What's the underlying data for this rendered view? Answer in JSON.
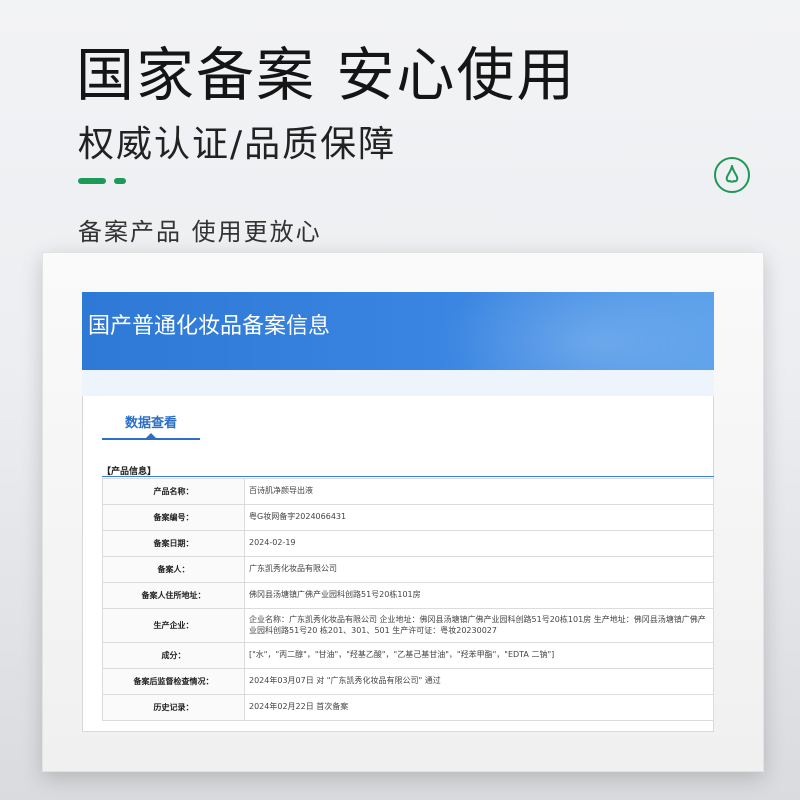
{
  "hero": {
    "title": "国家备案 安心使用",
    "subtitle": "权威认证/品质保障",
    "tagline": "备案产品 使用更放心",
    "accent_color": "#1e9a58",
    "badge_icon": "nose-icon"
  },
  "screen": {
    "banner_title": "国产普通化妆品备案信息",
    "tab_label": "数据查看",
    "section_title": "【产品信息】",
    "rows": [
      {
        "label": "产品名称：",
        "value": "百诗肌净颜导出液"
      },
      {
        "label": "备案编号：",
        "value": "粤G妆网备字2024066431"
      },
      {
        "label": "备案日期：",
        "value": "2024-02-19"
      },
      {
        "label": "备案人：",
        "value": "广东凯秀化妆品有限公司"
      },
      {
        "label": "备案人住所地址：",
        "value": "佛冈县汤塘镇广佛产业园科创路51号20栋101房"
      },
      {
        "label": "生产企业：",
        "value": "企业名称：广东凯秀化妆品有限公司 企业地址：佛冈县汤塘镇广佛产业园科创路51号20栋101房 生产地址：佛冈县汤塘镇广佛产业园科创路51号20 栋201、301、501 生产许可证：粤妆20230027"
      },
      {
        "label": "成分：",
        "value": "[\"水\"，\"丙二醇\"，\"甘油\"，\"羟基乙酸\"，\"乙基己基甘油\"，\"羟苯甲酯\"，\"EDTA 二钠\"]"
      },
      {
        "label": "备案后监督检查情况：",
        "value": "2024年03月07日 对 \"广东凯秀化妆品有限公司\" 通过"
      },
      {
        "label": "历史记录：",
        "value": "2024年02月22日 首次备案"
      }
    ]
  }
}
